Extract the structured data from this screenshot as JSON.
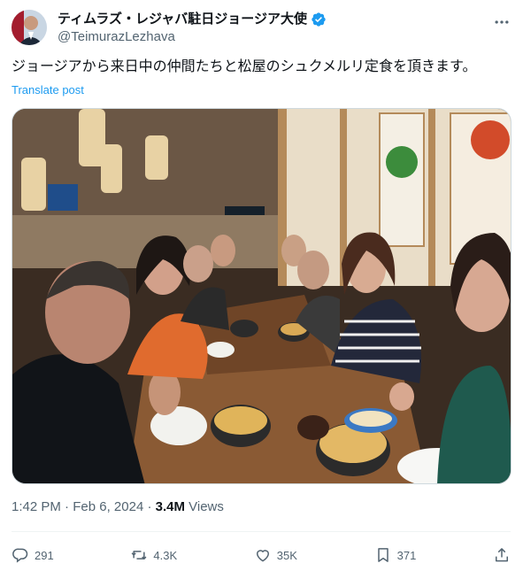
{
  "author": {
    "display_name": "ティムラズ・レジャバ駐日ジョージア大使",
    "handle": "@TeimurazLezhava",
    "verified_icon": "verified-badge-icon",
    "colors": {
      "verified": "#1d9bf0"
    }
  },
  "tweet": {
    "text": "ジョージアから来日中の仲間たちと松屋のシュクメルリ定食を頂きます。",
    "translate_label": "Translate post"
  },
  "meta": {
    "time": "1:42 PM",
    "separator": " · ",
    "date": "Feb 6, 2024",
    "views_count": "3.4M",
    "views_label": " Views"
  },
  "actions": {
    "replies": "291",
    "reposts": "4.3K",
    "likes": "35K",
    "bookmarks": "371"
  },
  "icons": [
    "more-icon",
    "reply-icon",
    "repost-icon",
    "like-icon",
    "bookmark-icon",
    "share-icon"
  ]
}
